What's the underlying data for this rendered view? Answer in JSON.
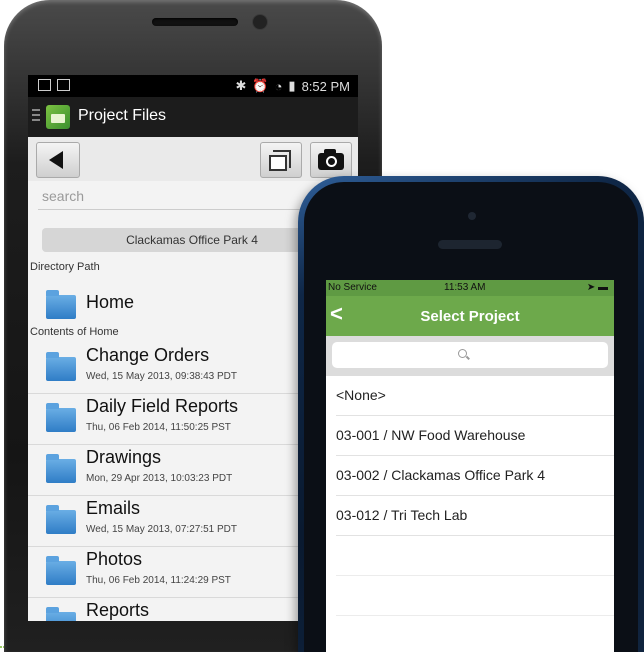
{
  "android": {
    "status_time": "8:52 PM",
    "app_title": "Project Files",
    "search_placeholder": "search",
    "project_name": "Clackamas Office Park 4",
    "directory_path_label": "Directory Path",
    "home_label": "Home",
    "contents_label": "Contents of Home",
    "folders": [
      {
        "name": "Change Orders",
        "date": "Wed, 15 May 2013, 09:38:43 PDT"
      },
      {
        "name": "Daily Field Reports",
        "date": "Thu, 06 Feb 2014, 11:50:25 PST"
      },
      {
        "name": "Drawings",
        "date": "Mon, 29 Apr 2013, 10:03:23 PDT"
      },
      {
        "name": "Emails",
        "date": "Wed, 15 May 2013, 07:27:51 PDT"
      },
      {
        "name": "Photos",
        "date": "Thu, 06 Feb 2014, 11:24:29 PST"
      },
      {
        "name": "Reports",
        "date": ""
      }
    ]
  },
  "iphone": {
    "carrier": "No Service",
    "time": "11:53 AM",
    "back_label": "<",
    "nav_title": "Select Project",
    "projects": [
      "<None>",
      "03-001 / NW Food Warehouse",
      "03-002 / Clackamas Office Park 4",
      "03-012 / Tri Tech Lab"
    ]
  },
  "colors": {
    "ios_green": "#6da94b",
    "folder_blue": "#2f7dc6"
  }
}
